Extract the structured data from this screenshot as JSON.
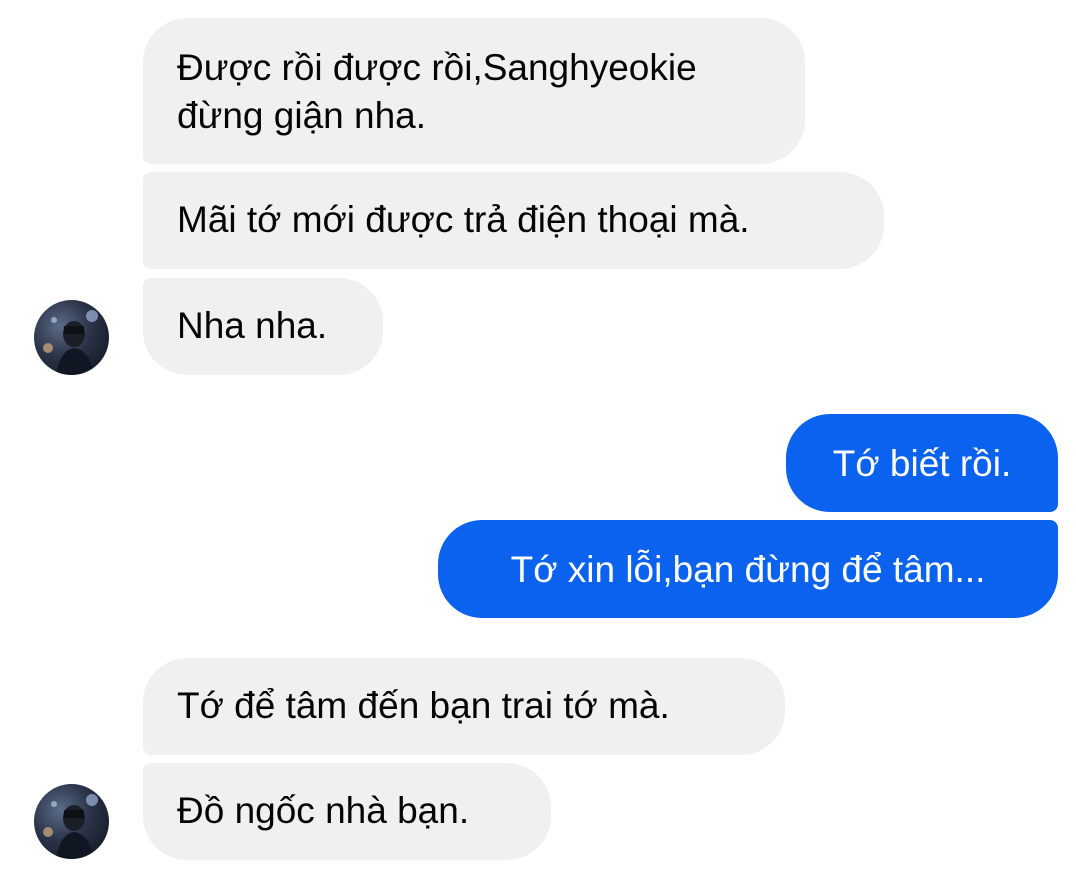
{
  "conversation": {
    "messages": [
      {
        "sender": "other",
        "lines": [
          "Được rồi được rồi,Sanghyeokie",
          "đừng giận nha."
        ]
      },
      {
        "sender": "other",
        "text": "Mãi tớ mới được trả điện thoại mà."
      },
      {
        "sender": "other",
        "text": "Nha nha."
      },
      {
        "sender": "me",
        "text": "Tớ biết rồi."
      },
      {
        "sender": "me",
        "text": "Tớ xin lỗi,bạn đừng để tâm..."
      },
      {
        "sender": "other",
        "text": "Tớ để tâm đến bạn trai tớ mà."
      },
      {
        "sender": "other",
        "text": "Đồ ngốc nhà bạn."
      }
    ]
  },
  "avatar_icon": "profile-photo",
  "colors": {
    "incoming_bubble": "#f0f0f0",
    "outgoing_bubble": "#0a62ee",
    "incoming_text": "#050505",
    "outgoing_text": "#ffffff",
    "background": "#ffffff"
  }
}
